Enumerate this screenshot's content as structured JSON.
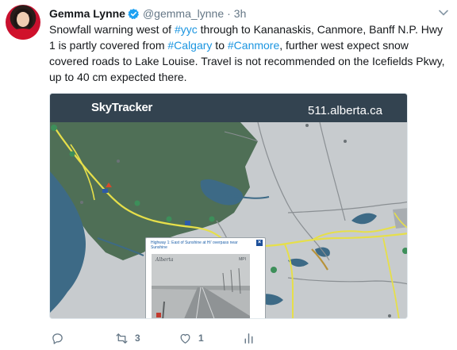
{
  "tweet": {
    "author": {
      "display_name": "Gemma Lynne",
      "handle": "@gemma_lynne",
      "verified": true
    },
    "separator": "·",
    "timestamp": "3h",
    "text_parts": [
      {
        "text": "Snowfall warning west of ",
        "hashtag": false
      },
      {
        "text": "#yyc",
        "hashtag": true
      },
      {
        "text": " through to Kananaskis, Canmore, Banff N.P. Hwy 1 is partly covered from ",
        "hashtag": false
      },
      {
        "text": "#Calgary",
        "hashtag": true
      },
      {
        "text": " to ",
        "hashtag": false
      },
      {
        "text": "#Canmore",
        "hashtag": true
      },
      {
        "text": ", further west expect snow covered roads to Lake Louise. Travel is not recommended on the Icefields Pkwy, up to 40 cm expected there.",
        "hashtag": false
      }
    ],
    "media": {
      "brand": "SkyTracker",
      "site": "511.alberta.ca",
      "popup_title": "Highway 1: East of Sunshine at Hi' overpass near Sunshine",
      "camera_logo": "Alberta",
      "camera_id": "MPI"
    },
    "actions": {
      "reply_count": "",
      "retweet_count": "3",
      "like_count": "1"
    },
    "colors": {
      "hashtag": "#1b95e0",
      "muted": "#657786",
      "verified": "#1da1f2",
      "banner": "#223442",
      "forest": "#4f6f56",
      "water": "#3d6a86",
      "highway": "#e6df4a"
    }
  }
}
